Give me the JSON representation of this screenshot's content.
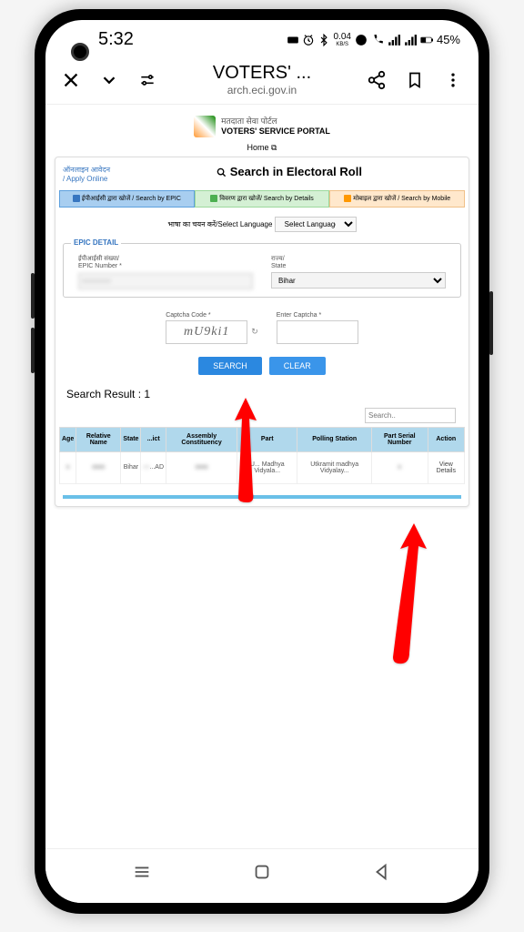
{
  "status": {
    "time": "5:32",
    "speed": "0.04",
    "speed_unit": "KB/S",
    "battery": "45%"
  },
  "browser": {
    "title": "VOTERS' ...",
    "url": "arch.eci.gov.in"
  },
  "portal": {
    "hindi_title": "मतदाता सेवा पोर्टल",
    "eng_title": "VOTERS' SERVICE PORTAL",
    "home_label": "Home"
  },
  "sidebar": {
    "apply_hi": "ऑनलाइन आवेदन",
    "apply_en": "/ Apply Online"
  },
  "search": {
    "title": "Search in Electoral Roll",
    "tabs": {
      "epic": "ईपीआईसी द्वारा खोजें / Search by EPIC",
      "details": "विवरण द्वारा खोजें/ Search by Details",
      "mobile": "मोबाइल द्वारा खोजें / Search by Mobile"
    },
    "lang_label": "भाषा का चयन करें/Select Language",
    "lang_placeholder": "Select Language",
    "epic_legend": "EPIC DETAIL",
    "epic_label_hi": "ईपीआईसी संख्या/",
    "epic_label_en": "EPIC Number *",
    "state_label_hi": "राज्य/",
    "state_label_en": "State",
    "state_value": "Bihar",
    "captcha_label": "Captcha Code *",
    "enter_captcha": "Enter Captcha *",
    "captcha_text": "mU9ki1",
    "search_btn": "SEARCH",
    "clear_btn": "CLEAR"
  },
  "results": {
    "title": "Search Result : 1",
    "filter_placeholder": "Search..",
    "headers": {
      "age": "Age",
      "relative": "Relative Name",
      "state": "State",
      "district": "...ict",
      "assembly": "Assembly Constituency",
      "part": "Part",
      "polling": "Polling Station",
      "serial": "Part Serial Number",
      "action": "Action"
    },
    "row": {
      "state": "Bihar",
      "district": "...AD",
      "part": "U... Madhya Vidyala...",
      "polling": "Utkramit madhya Vidyalay...",
      "action": "View Details"
    }
  }
}
